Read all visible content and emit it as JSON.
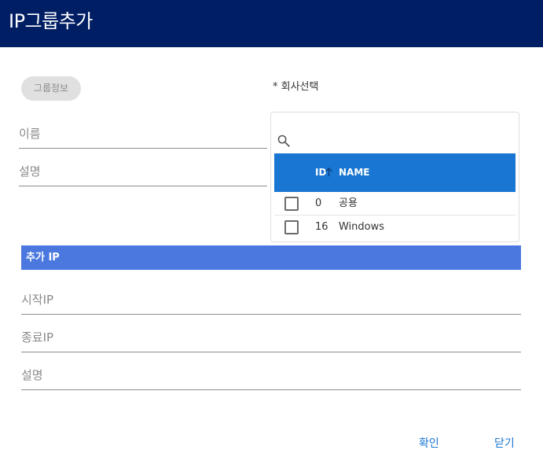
{
  "dialog": {
    "title": "IP그룹추가"
  },
  "group_info": {
    "chip_label": "그룹정보",
    "name_placeholder": "이름",
    "description_placeholder": "설명"
  },
  "company": {
    "label": "* 회사선택",
    "search_placeholder": "",
    "columns": {
      "id": "ID",
      "name": "NAME"
    },
    "sort": "ascending",
    "rows": [
      {
        "id": "0",
        "name": "공용",
        "checked": false
      },
      {
        "id": "16",
        "name": "Windows",
        "checked": false
      }
    ],
    "header_color": "#1976d2"
  },
  "ip_section": {
    "title": "추가 IP",
    "start_ip_placeholder": "시작IP",
    "end_ip_placeholder": "종료IP",
    "description_placeholder": "설명",
    "bar_color": "#4a78de"
  },
  "actions": {
    "confirm_label": "확인",
    "close_label": "닫기"
  },
  "colors": {
    "titlebar": "#001e64",
    "accent": "#1976d2"
  }
}
